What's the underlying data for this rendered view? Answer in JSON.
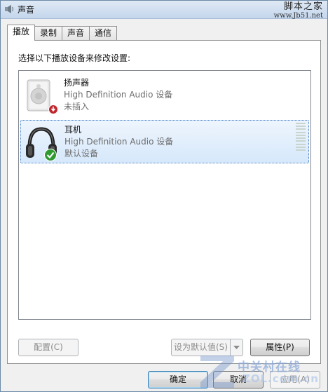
{
  "window": {
    "title": "声音",
    "site_watermark": "脚本之家",
    "site_watermark_url": "www.Jb51.net"
  },
  "tabs": [
    {
      "label": "播放",
      "active": true
    },
    {
      "label": "录制",
      "active": false
    },
    {
      "label": "声音",
      "active": false
    },
    {
      "label": "通信",
      "active": false
    }
  ],
  "panel": {
    "instruction": "选择以下播放设备来修改设置:"
  },
  "devices": [
    {
      "name": "扬声器",
      "description": "High Definition Audio 设备",
      "status": "未插入",
      "icon": "speaker-icon",
      "badge": "unplugged-badge-icon",
      "selected": false
    },
    {
      "name": "耳机",
      "description": "High Definition Audio 设备",
      "status": "默认设备",
      "icon": "headphones-icon",
      "badge": "default-checkmark-icon",
      "selected": true
    }
  ],
  "buttons": {
    "configure": "配置(C)",
    "set_default": "设为默认值(S)",
    "properties": "属性(P)",
    "ok": "确定",
    "cancel": "取消",
    "apply": "应用(A)"
  },
  "watermark": {
    "zol_main": "中关村在线",
    "zol_sub": "ZOL.com.cn"
  },
  "colors": {
    "selection": "#d6e8fb",
    "selection_border": "#3d7dc4",
    "checkmark": "#2f9a2f",
    "unplugged": "#c0272d"
  }
}
